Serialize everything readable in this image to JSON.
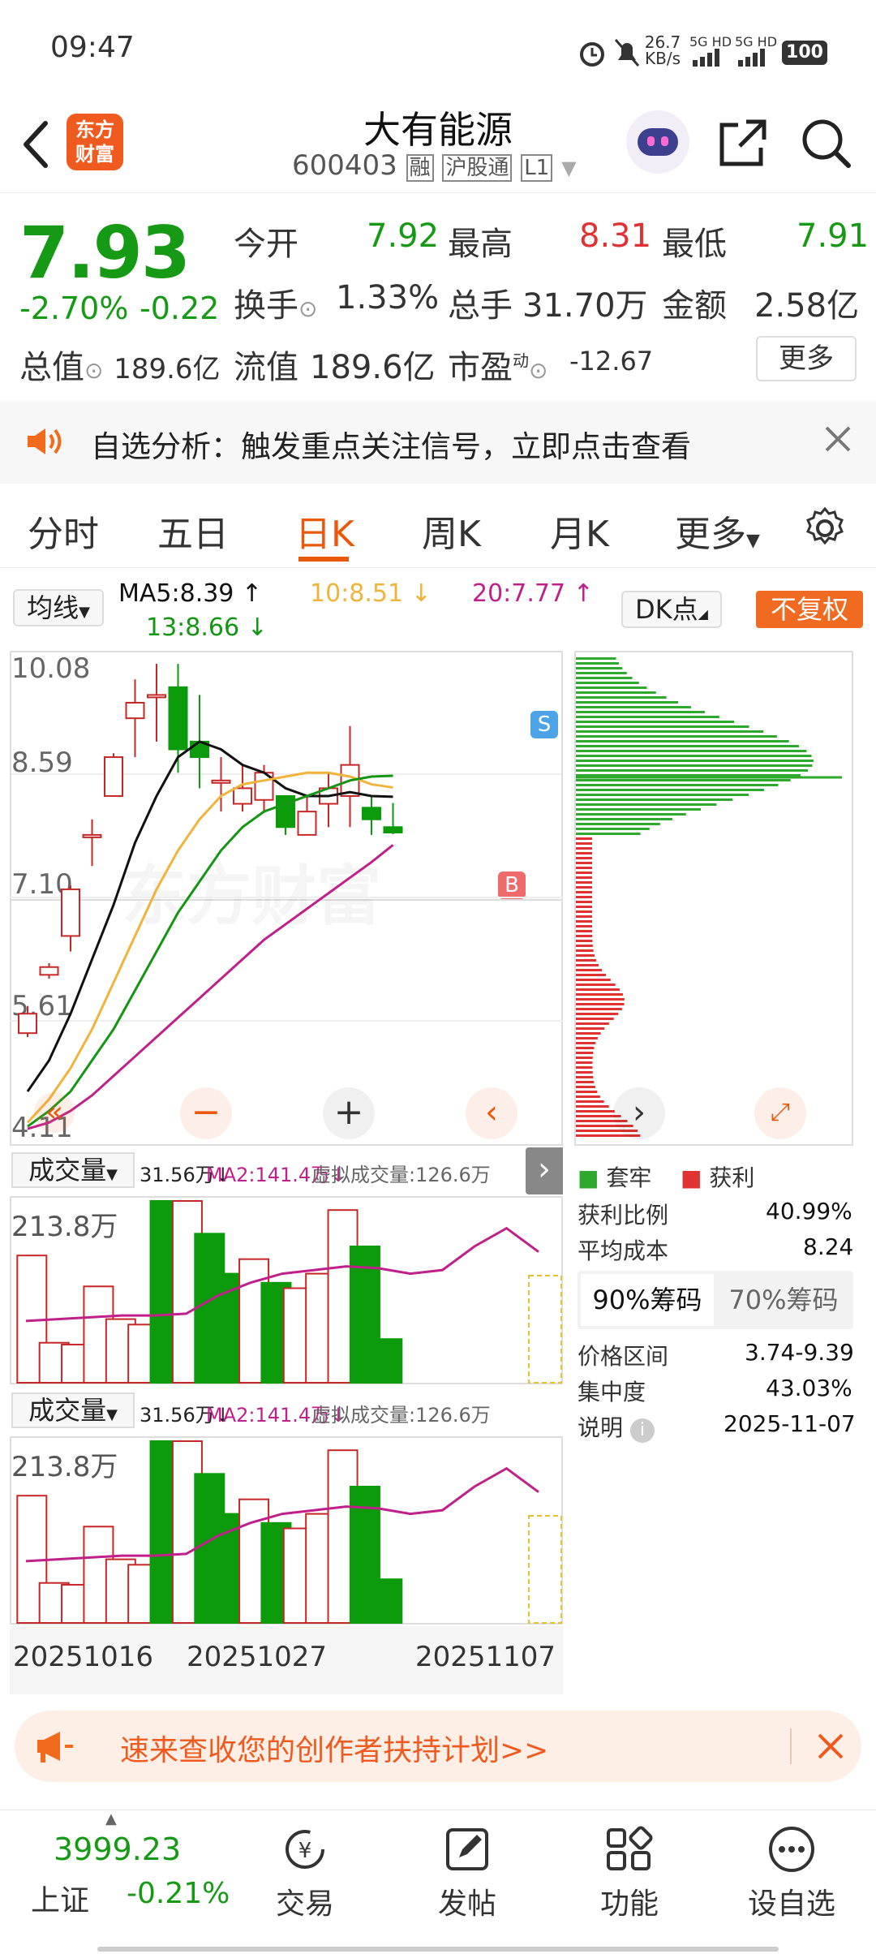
{
  "status": {
    "time": "09:47",
    "net_speed": "26.7",
    "net_unit": "KB/s",
    "sim1": "5G HD",
    "sim2": "5G HD",
    "battery": "100"
  },
  "header": {
    "title": "大有能源",
    "code": "600403",
    "tag_rong": "融",
    "tag_hgt": "沪股通",
    "tag_level": "L1",
    "logo_line1": "东方",
    "logo_line2": "财富"
  },
  "quote": {
    "price": "7.93",
    "change_pct": "-2.70%",
    "change": "-0.22",
    "open_label": "今开",
    "open": "7.92",
    "high_label": "最高",
    "high": "8.31",
    "low_label": "最低",
    "low": "7.91",
    "turnover_label": "换手",
    "turnover": "1.33%",
    "volume_label": "总手",
    "volume": "31.70万",
    "amount_label": "金额",
    "amount": "2.58亿",
    "mcap_label": "总值",
    "mcap": "189.6亿",
    "float_label": "流值",
    "float": "189.6亿",
    "pe_label": "市盈",
    "pe_sup": "动",
    "pe": "-12.67",
    "more_button": "更多"
  },
  "notice": {
    "text": "自选分析：触发重点关注信号，立即点击查看"
  },
  "tabs": [
    "分时",
    "五日",
    "日K",
    "周K",
    "月K",
    "更多"
  ],
  "active_tab": 2,
  "kchart": {
    "ma_selector": "均线",
    "ma5": "MA5:8.39 ↑",
    "ma10": "10:8.51 ↓",
    "ma20": "20:7.77 ↑",
    "ma13": "13:8.66 ↓",
    "dk_button": "DK点",
    "fq_button": "不复权",
    "y_labels": [
      "10.08",
      "8.59",
      "7.10",
      "5.61",
      "4.11"
    ],
    "s_marker": "S",
    "b_marker": "B",
    "watermark": "东方财富"
  },
  "volume1": {
    "selector": "成交量",
    "value": "31.56万↓",
    "ma2": "MA2:141.4万↓",
    "virtual": "虚拟成交量:126.6万",
    "ymax": "213.8万"
  },
  "volume2": {
    "selector": "成交量",
    "value": "31.56万↓",
    "ma2": "MA2:141.4万↓",
    "virtual": "虚拟成交量:126.6万",
    "ymax": "213.8万"
  },
  "x_dates": [
    "20251016",
    "20251027",
    "20251107"
  ],
  "chips": {
    "legend_trapped": "套牢",
    "legend_profit": "获利",
    "profit_ratio_label": "获利比例",
    "profit_ratio": "40.99%",
    "avg_cost_label": "平均成本",
    "avg_cost": "8.24",
    "tab90": "90%筹码",
    "tab70": "70%筹码",
    "range_label": "价格区间",
    "range": "3.74-9.39",
    "concentration_label": "集中度",
    "concentration": "43.03%",
    "note_label": "说明",
    "date": "2025-11-07"
  },
  "banner": {
    "text": "速来查收您的创作者扶持计划>>"
  },
  "bottom": {
    "index_value": "3999.23",
    "index_name": "上证",
    "index_change": "-0.21%",
    "nav": [
      "交易",
      "发帖",
      "功能",
      "设自选"
    ]
  },
  "colors": {
    "up": "#c62828",
    "down": "#0a9a0a",
    "accent": "#e8590c",
    "ma5": "#111111",
    "ma10": "#f0b43c",
    "ma20": "#c0208a",
    "ma13": "#149614"
  }
}
